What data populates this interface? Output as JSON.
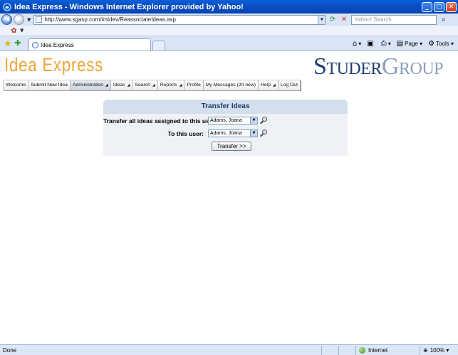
{
  "window": {
    "title": "Idea Express - Windows Internet Explorer provided by Yahoo!",
    "minimize": "_",
    "maximize": "□",
    "close": "✕"
  },
  "address_bar": {
    "url": "http://www.sgasp.com/imIdev/ReassociateIdeas.asp",
    "search_placeholder": "Yahoo! Search"
  },
  "tab": {
    "label": "Idea Express"
  },
  "command_bar": {
    "page_label": "Page",
    "tools_label": "Tools"
  },
  "brand": {
    "left_logo": "Idea Express",
    "right_logo_part1": "Studer",
    "right_logo_part2": "Group"
  },
  "menu": [
    {
      "label": "Welcome",
      "arrow": false
    },
    {
      "label": "Submit New Idea",
      "arrow": false
    },
    {
      "label": "Administration",
      "arrow": true
    },
    {
      "label": "Ideas",
      "arrow": true
    },
    {
      "label": "Search",
      "arrow": true
    },
    {
      "label": "Reports",
      "arrow": true
    },
    {
      "label": "Profile",
      "arrow": false
    },
    {
      "label": "My Messages (20 new)",
      "arrow": false
    },
    {
      "label": "Help",
      "arrow": true
    },
    {
      "label": "Log Out",
      "arrow": false
    }
  ],
  "transfer_panel": {
    "heading": "Transfer Ideas",
    "from_label": "Transfer all ideas assigned to this user:",
    "from_value": "Adams, Joana",
    "to_label": "To this user:",
    "to_value": "Adams, Joana",
    "submit_label": "Transfer >>"
  },
  "status_bar": {
    "status": "Done",
    "zone": "Internet",
    "zoom": "100%"
  },
  "colors": {
    "titlebar": "#0b4fc4",
    "brand_orange": "#f0a23a",
    "brand_navy": "#1f3f73",
    "panel_head": "#d4dfec"
  }
}
